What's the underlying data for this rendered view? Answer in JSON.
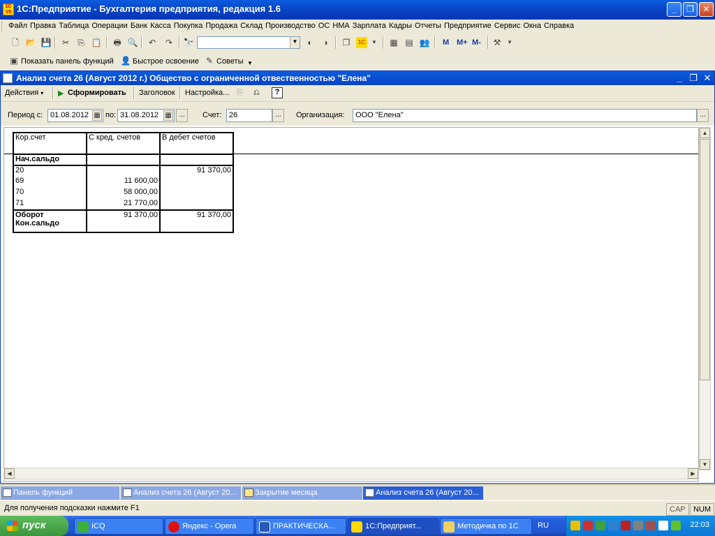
{
  "app": {
    "title": "1С:Предприятие - Бухгалтерия предприятия, редакция 1.6",
    "icon_text": "1C V8"
  },
  "menu": [
    "Файл",
    "Правка",
    "Таблица",
    "Операции",
    "Банк",
    "Касса",
    "Покупка",
    "Продажа",
    "Склад",
    "Производство",
    "ОС",
    "НМА",
    "Зарплата",
    "Кадры",
    "Отчеты",
    "Предприятие",
    "Сервис",
    "Окна",
    "Справка"
  ],
  "toolbar2": {
    "show_panel": "Показать панель функций",
    "quick_start": "Быстрое освоение",
    "tips": "Советы"
  },
  "memory_buttons": [
    "M",
    "M+",
    "M-"
  ],
  "report_window": {
    "title": "Анализ счета 26 (Август 2012 г.) Общество с ограниченной отвественностью \"Елена\"",
    "actions": {
      "actions_menu": "Действия",
      "generate": "Сформировать",
      "header": "Заголовок",
      "settings": "Настройка..."
    },
    "params": {
      "period_from_label": "Период с:",
      "period_from": "01.08.2012",
      "period_to_label": "по:",
      "period_to": "31.08.2012",
      "account_label": "Счет:",
      "account": "26",
      "org_label": "Организация:",
      "org": "ООО \"Елена\""
    },
    "table": {
      "headers": [
        "Кор.счет",
        "С кред. счетов",
        "В дебет счетов"
      ],
      "opening": "Нач.сальдо",
      "rows": [
        {
          "acc": "20",
          "credit": "",
          "debit": "91 370,00"
        },
        {
          "acc": "69",
          "credit": "11 600,00",
          "debit": ""
        },
        {
          "acc": "70",
          "credit": "58 000,00",
          "debit": ""
        },
        {
          "acc": "71",
          "credit": "21 770,00",
          "debit": ""
        }
      ],
      "turnover_label": "Оборот",
      "turnover_credit": "91 370,00",
      "turnover_debit": "91 370,00",
      "closing": "Кон.сальдо"
    }
  },
  "window_tabs": [
    "Панель функций",
    "Анализ счета 26 (Август 20...",
    "Закрытие месяца",
    "Анализ счета 26 (Август 20..."
  ],
  "status": {
    "hint": "Для получения подсказки нажмите F1",
    "cap": "CAP",
    "num": "NUM"
  },
  "taskbar": {
    "start": "пуск",
    "tasks": [
      "ICQ",
      "Яндекс - Opera",
      "ПРАКТИЧЕСКА...",
      "1С:Предприят...",
      "Методичка по 1С"
    ],
    "lang": "RU",
    "clock": "22:03"
  }
}
